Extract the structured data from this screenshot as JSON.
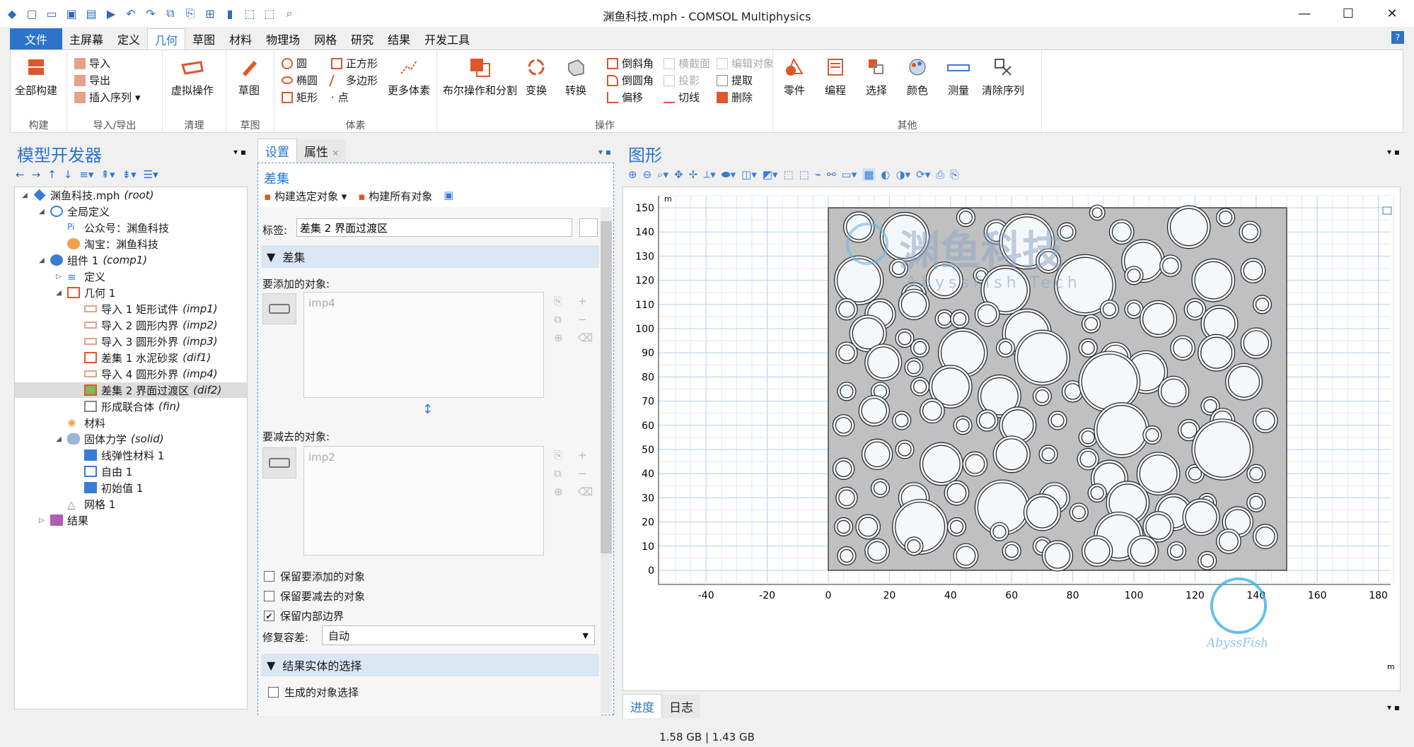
{
  "window": {
    "title": "渊鱼科技.mph - COMSOL Multiphysics"
  },
  "menu": {
    "items": [
      "文件",
      "主屏幕",
      "定义",
      "几何",
      "草图",
      "材料",
      "物理场",
      "网格",
      "研究",
      "结果",
      "开发工具"
    ],
    "active": "几何",
    "help": "?"
  },
  "ribbon": {
    "build_all": "全部构建",
    "import": "导入",
    "export": "导出",
    "insert_sequence": "插入序列",
    "virtual_ops": "虚拟操作",
    "sketch": "草图",
    "circle": "圆",
    "square": "正方形",
    "ellipse": "椭圆",
    "polygon": "多边形",
    "rectangle": "矩形",
    "point": "点",
    "more_primitives": "更多体素",
    "boolean": "布尔操作和分割",
    "transform": "变换",
    "convert": "转换",
    "chamfer": "倒斜角",
    "cross_section": "横截面",
    "edit_object": "编辑对象",
    "fillet": "倒圆角",
    "projection": "投影",
    "extract": "提取",
    "offset": "偏移",
    "tangent": "切线",
    "delete": "删除",
    "parts": "零件",
    "programming": "编程",
    "selections": "选择",
    "colors": "颜色",
    "measure": "测量",
    "clear_sequence": "清除序列",
    "groups": {
      "build": "构建",
      "import_export": "导入/导出",
      "cleanup": "清理",
      "sketch": "草图",
      "primitives": "体素",
      "operations": "操作",
      "other": "其他"
    }
  },
  "model_builder": {
    "title": "模型开发器",
    "tree": [
      {
        "label": "渊鱼科技.mph",
        "tag": "(root)",
        "level": 0
      },
      {
        "label": "全局定义",
        "tag": "",
        "level": 1
      },
      {
        "label": "公众号：渊鱼科技",
        "tag": "",
        "level": 2
      },
      {
        "label": "淘宝：渊鱼科技",
        "tag": "",
        "level": 2
      },
      {
        "label": "组件 1",
        "tag": "(comp1)",
        "level": 1
      },
      {
        "label": "定义",
        "tag": "",
        "level": 2
      },
      {
        "label": "几何 1",
        "tag": "",
        "level": 2
      },
      {
        "label": "导入 1 矩形试件",
        "tag": "(imp1)",
        "level": 3
      },
      {
        "label": "导入 2 圆形内界",
        "tag": "(imp2)",
        "level": 3
      },
      {
        "label": "导入 3 圆形外界",
        "tag": "(imp3)",
        "level": 3
      },
      {
        "label": "差集 1 水泥砂浆",
        "tag": "(dif1)",
        "level": 3
      },
      {
        "label": "导入 4 圆形外界",
        "tag": "(imp4)",
        "level": 3
      },
      {
        "label": "差集 2 界面过渡区",
        "tag": "(dif2)",
        "level": 3
      },
      {
        "label": "形成联合体",
        "tag": "(fin)",
        "level": 3
      },
      {
        "label": "材料",
        "tag": "",
        "level": 2
      },
      {
        "label": "固体力学",
        "tag": "(solid)",
        "level": 2
      },
      {
        "label": "线弹性材料 1",
        "tag": "",
        "level": 3
      },
      {
        "label": "自由 1",
        "tag": "",
        "level": 3
      },
      {
        "label": "初始值 1",
        "tag": "",
        "level": 3
      },
      {
        "label": "网格 1",
        "tag": "",
        "level": 2
      },
      {
        "label": "结果",
        "tag": "",
        "level": 1
      }
    ]
  },
  "settings": {
    "tab_settings": "设置",
    "tab_properties": "属性",
    "heading": "差集",
    "build_selected": "构建选定对象",
    "build_all": "构建所有对象",
    "label_caption": "标签:",
    "label_value": "差集 2 界面过渡区",
    "section_difference": "差集",
    "objects_to_add": "要添加的对象:",
    "add_item": "imp4",
    "objects_to_subtract": "要减去的对象:",
    "subtract_item": "imp2",
    "keep_add": "保留要添加的对象",
    "keep_subtract": "保留要减去的对象",
    "keep_interior": "保留内部边界",
    "repair_tol_caption": "修复容差:",
    "repair_tol_value": "自动",
    "section_result": "结果实体的选择",
    "resulting_selection": "生成的对象选择"
  },
  "graphics": {
    "title": "图形",
    "unit_label": "m",
    "x_ticks": [
      "-40",
      "-20",
      "0",
      "20",
      "40",
      "60",
      "80",
      "100",
      "120",
      "140",
      "160",
      "180"
    ],
    "y_ticks": [
      "150",
      "140",
      "130",
      "120",
      "110",
      "100",
      "90",
      "80",
      "70",
      "60",
      "50",
      "40",
      "30",
      "20",
      "10",
      "0"
    ],
    "watermark_cn": "渊鱼科技",
    "watermark_en": "AbyssFish Tech",
    "watermark_small": "AbyssFish"
  },
  "bottom_tabs": {
    "progress": "进度",
    "log": "日志"
  },
  "status": {
    "memory": "1.58 GB | 1.43 GB"
  }
}
